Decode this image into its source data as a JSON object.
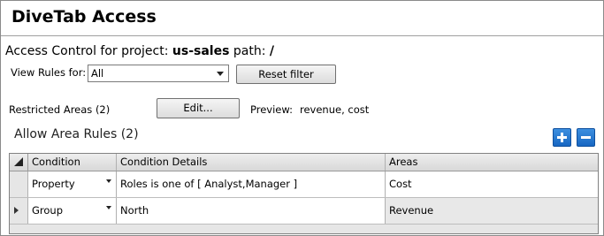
{
  "window": {
    "title": "DiveTab Access"
  },
  "access_control": {
    "prefix": "Access Control for project:",
    "project": "us-sales",
    "path_label": "path:",
    "path": "/"
  },
  "filter": {
    "label": "View Rules for:",
    "selected": "All",
    "reset_label": "Reset filter"
  },
  "restricted": {
    "label": "Restricted Areas (2)",
    "edit_label": "Edit...",
    "preview_label": "Preview:",
    "preview_value": "revenue, cost"
  },
  "allow_rules": {
    "header": "Allow Area Rules (2)",
    "columns": [
      "Condition",
      "Condition Details",
      "Areas"
    ],
    "rows": [
      {
        "condition": "Property",
        "details": "Roles is one of [ Analyst,Manager ]",
        "areas": "Cost"
      },
      {
        "condition": "Group",
        "details": "North",
        "areas": "Revenue"
      }
    ]
  },
  "colors": {
    "accent": "#1f72d0",
    "header_bg": "#dcdcdc",
    "selected_row_bg": "#e8e8e8"
  }
}
